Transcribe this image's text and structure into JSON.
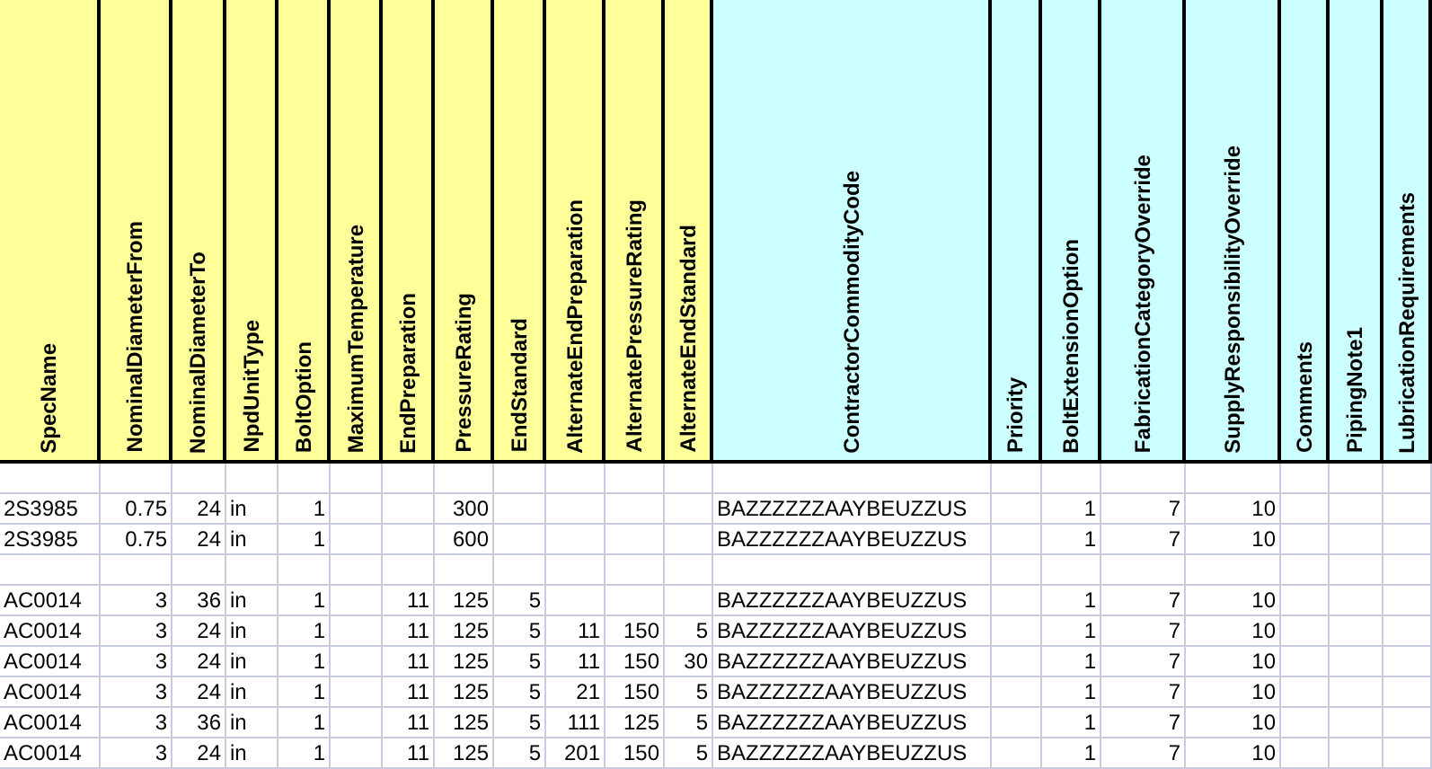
{
  "table": {
    "columns": [
      {
        "label": "SpecName",
        "kind": "text",
        "color": "#ffff99"
      },
      {
        "label": "NominalDiameterFrom",
        "kind": "number",
        "color": "#ffff99"
      },
      {
        "label": "NominalDiameterTo",
        "kind": "number",
        "color": "#ffff99"
      },
      {
        "label": "NpdUnitType",
        "kind": "text",
        "color": "#ffff99"
      },
      {
        "label": "BoltOption",
        "kind": "number",
        "color": "#ffff99"
      },
      {
        "label": "MaximumTemperature",
        "color": "#ffff99"
      },
      {
        "label": "EndPreparation",
        "kind": "number",
        "color": "#ffff99"
      },
      {
        "label": "PressureRating",
        "kind": "number",
        "color": "#ffff99"
      },
      {
        "label": "EndStandard",
        "kind": "number",
        "color": "#ffff99"
      },
      {
        "label": "AlternateEndPreparation",
        "kind": "number",
        "color": "#ffff99"
      },
      {
        "label": "AlternatePressureRating",
        "kind": "number",
        "color": "#ffff99"
      },
      {
        "label": "AlternateEndStandard",
        "kind": "number",
        "color": "#ffff99"
      },
      {
        "label": "ContractorCommodityCode",
        "kind": "text",
        "color": "#ccffff"
      },
      {
        "label": "Priority",
        "color": "#ccffff"
      },
      {
        "label": "BoltExtensionOption",
        "kind": "number",
        "color": "#ccffff"
      },
      {
        "label": "FabricationCategoryOverride",
        "kind": "number",
        "color": "#ccffff"
      },
      {
        "label": "SupplyResponsibilityOverride",
        "kind": "number",
        "color": "#ccffff"
      },
      {
        "label": "Comments",
        "color": "#ccffff"
      },
      {
        "label": "PipingNote1",
        "color": "#ccffff"
      },
      {
        "label": "LubricationRequirements",
        "color": "#ccffff"
      }
    ],
    "rows": [
      [
        null,
        null,
        null,
        null,
        null,
        null,
        null,
        null,
        null,
        null,
        null,
        null,
        null,
        null,
        null,
        null,
        null,
        null,
        null,
        null
      ],
      [
        "2S3985",
        "0.75",
        "24",
        "in",
        "1",
        null,
        null,
        "300",
        null,
        null,
        null,
        null,
        "BAZZZZZZAAYBEUZZUS",
        null,
        "1",
        "7",
        "10",
        null,
        null,
        null
      ],
      [
        "2S3985",
        "0.75",
        "24",
        "in",
        "1",
        null,
        null,
        "600",
        null,
        null,
        null,
        null,
        "BAZZZZZZAAYBEUZZUS",
        null,
        "1",
        "7",
        "10",
        null,
        null,
        null
      ],
      [
        null,
        null,
        null,
        null,
        null,
        null,
        null,
        null,
        null,
        null,
        null,
        null,
        null,
        null,
        null,
        null,
        null,
        null,
        null,
        null
      ],
      [
        "AC0014",
        "3",
        "36",
        "in",
        "1",
        null,
        "11",
        "125",
        "5",
        null,
        null,
        null,
        "BAZZZZZZAAYBEUZZUS",
        null,
        "1",
        "7",
        "10",
        null,
        null,
        null
      ],
      [
        "AC0014",
        "3",
        "24",
        "in",
        "1",
        null,
        "11",
        "125",
        "5",
        "11",
        "150",
        "5",
        "BAZZZZZZAAYBEUZZUS",
        null,
        "1",
        "7",
        "10",
        null,
        null,
        null
      ],
      [
        "AC0014",
        "3",
        "24",
        "in",
        "1",
        null,
        "11",
        "125",
        "5",
        "11",
        "150",
        "30",
        "BAZZZZZZAAYBEUZZUS",
        null,
        "1",
        "7",
        "10",
        null,
        null,
        null
      ],
      [
        "AC0014",
        "3",
        "24",
        "in",
        "1",
        null,
        "11",
        "125",
        "5",
        "21",
        "150",
        "5",
        "BAZZZZZZAAYBEUZZUS",
        null,
        "1",
        "7",
        "10",
        null,
        null,
        null
      ],
      [
        "AC0014",
        "3",
        "36",
        "in",
        "1",
        null,
        "11",
        "125",
        "5",
        "111",
        "125",
        "5",
        "BAZZZZZZAAYBEUZZUS",
        null,
        "1",
        "7",
        "10",
        null,
        null,
        null
      ],
      [
        "AC0014",
        "3",
        "24",
        "in",
        "1",
        null,
        "11",
        "125",
        "5",
        "201",
        "150",
        "5",
        "BAZZZZZZAAYBEUZZUS",
        null,
        "1",
        "7",
        "10",
        null,
        null,
        null
      ]
    ]
  }
}
